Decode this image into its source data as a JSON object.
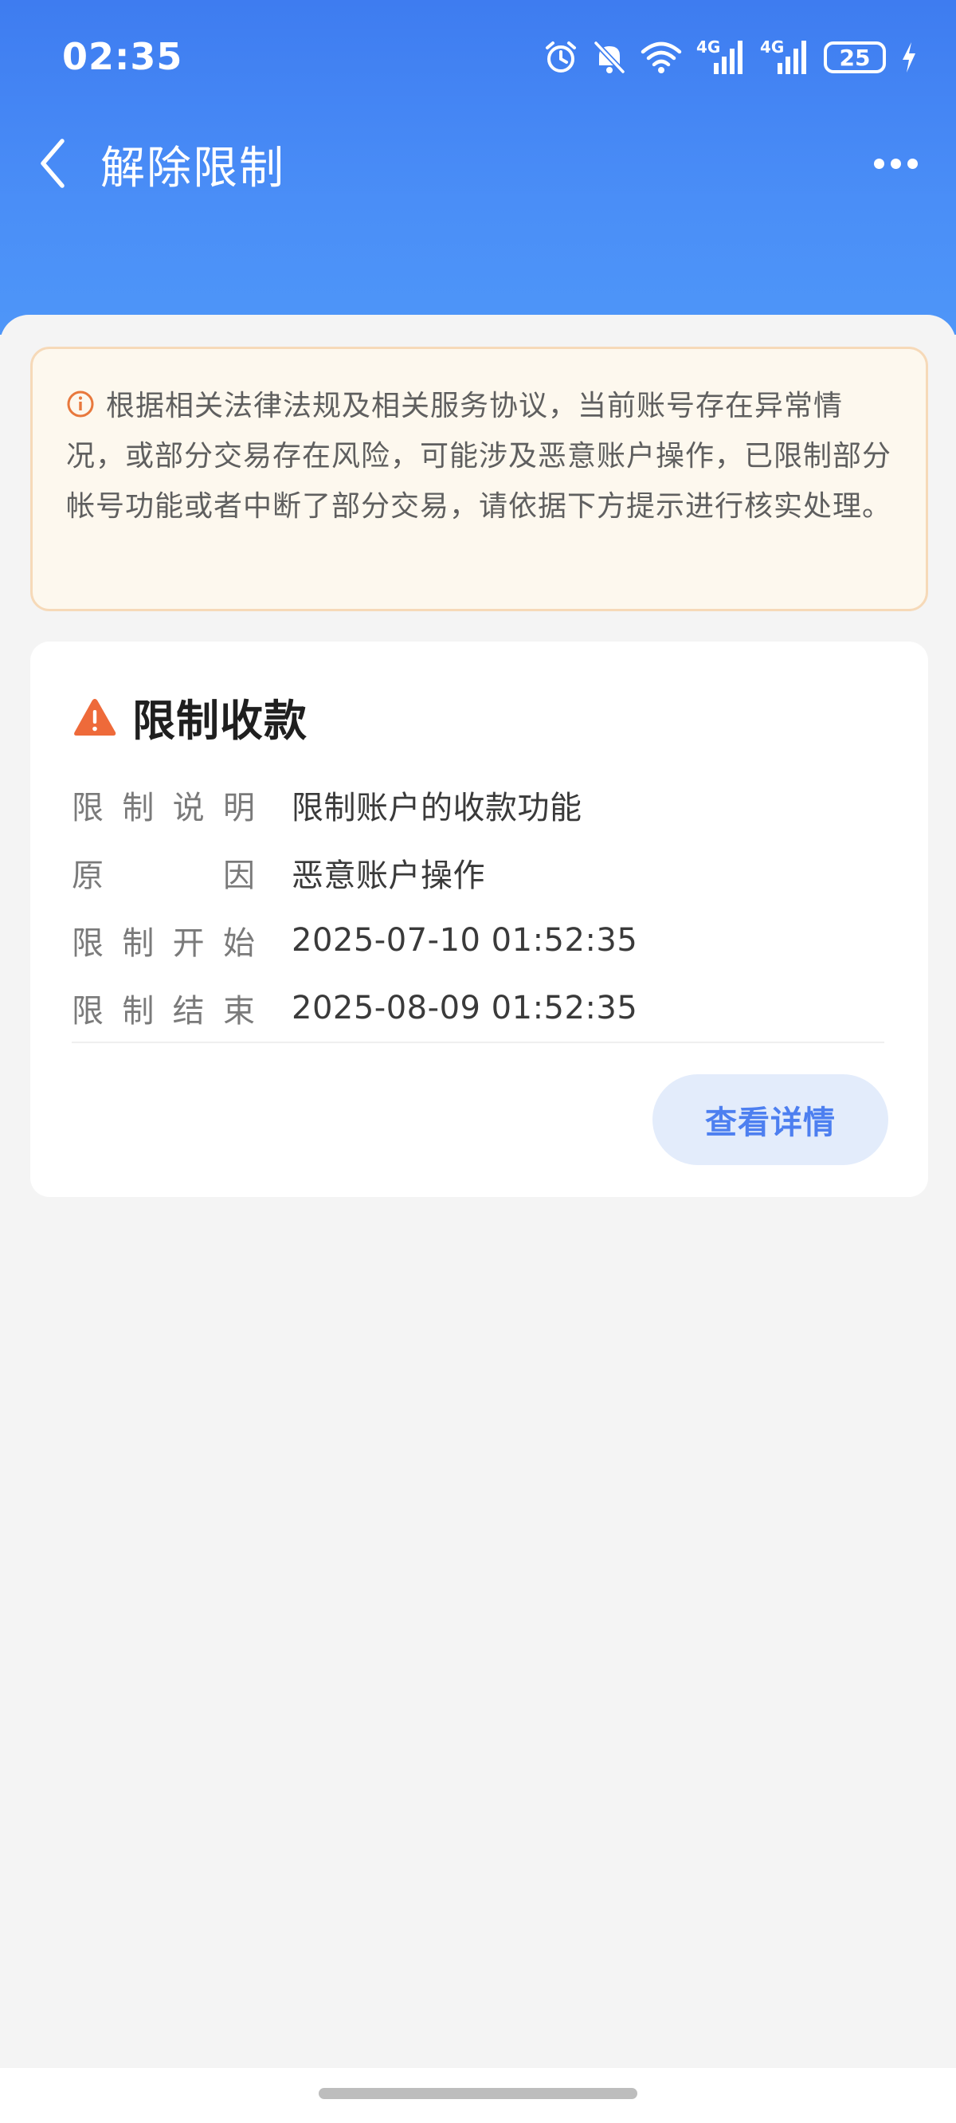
{
  "status_bar": {
    "time": "02:35",
    "network_1": "4G",
    "network_2": "4G",
    "battery": "25",
    "icons": [
      "alarm-icon",
      "bell-off-icon",
      "wifi-icon",
      "signal-icon",
      "signal-icon",
      "battery-icon",
      "charging-icon"
    ]
  },
  "nav": {
    "title": "解除限制",
    "back_icon": "chevron-left-icon",
    "more_icon": "more-dots-icon"
  },
  "notice": {
    "icon": "info-circle-icon",
    "text": "根据相关法律法规及相关服务协议，当前账号存在异常情况，或部分交易存在风险，可能涉及恶意账户操作，已限制部分帐号功能或者中断了部分交易，请依据下方提示进行核实处理。"
  },
  "card": {
    "icon": "warning-triangle-icon",
    "title": "限制收款",
    "rows": [
      {
        "key": [
          "限",
          "制",
          "说",
          "明"
        ],
        "value": "限制账户的收款功能"
      },
      {
        "key": [
          "原",
          "因"
        ],
        "value": "恶意账户操作"
      },
      {
        "key": [
          "限",
          "制",
          "开",
          "始"
        ],
        "value": "2025-07-10 01:52:35"
      },
      {
        "key": [
          "限",
          "制",
          "结",
          "束"
        ],
        "value": "2025-08-09 01:52:35"
      }
    ],
    "button_label": "查看详情"
  },
  "colors": {
    "header_blue": "#4a8ef7",
    "warning_orange": "#ee6a3a",
    "button_text": "#4d7ff0",
    "notice_bg": "#fdf8ee"
  }
}
